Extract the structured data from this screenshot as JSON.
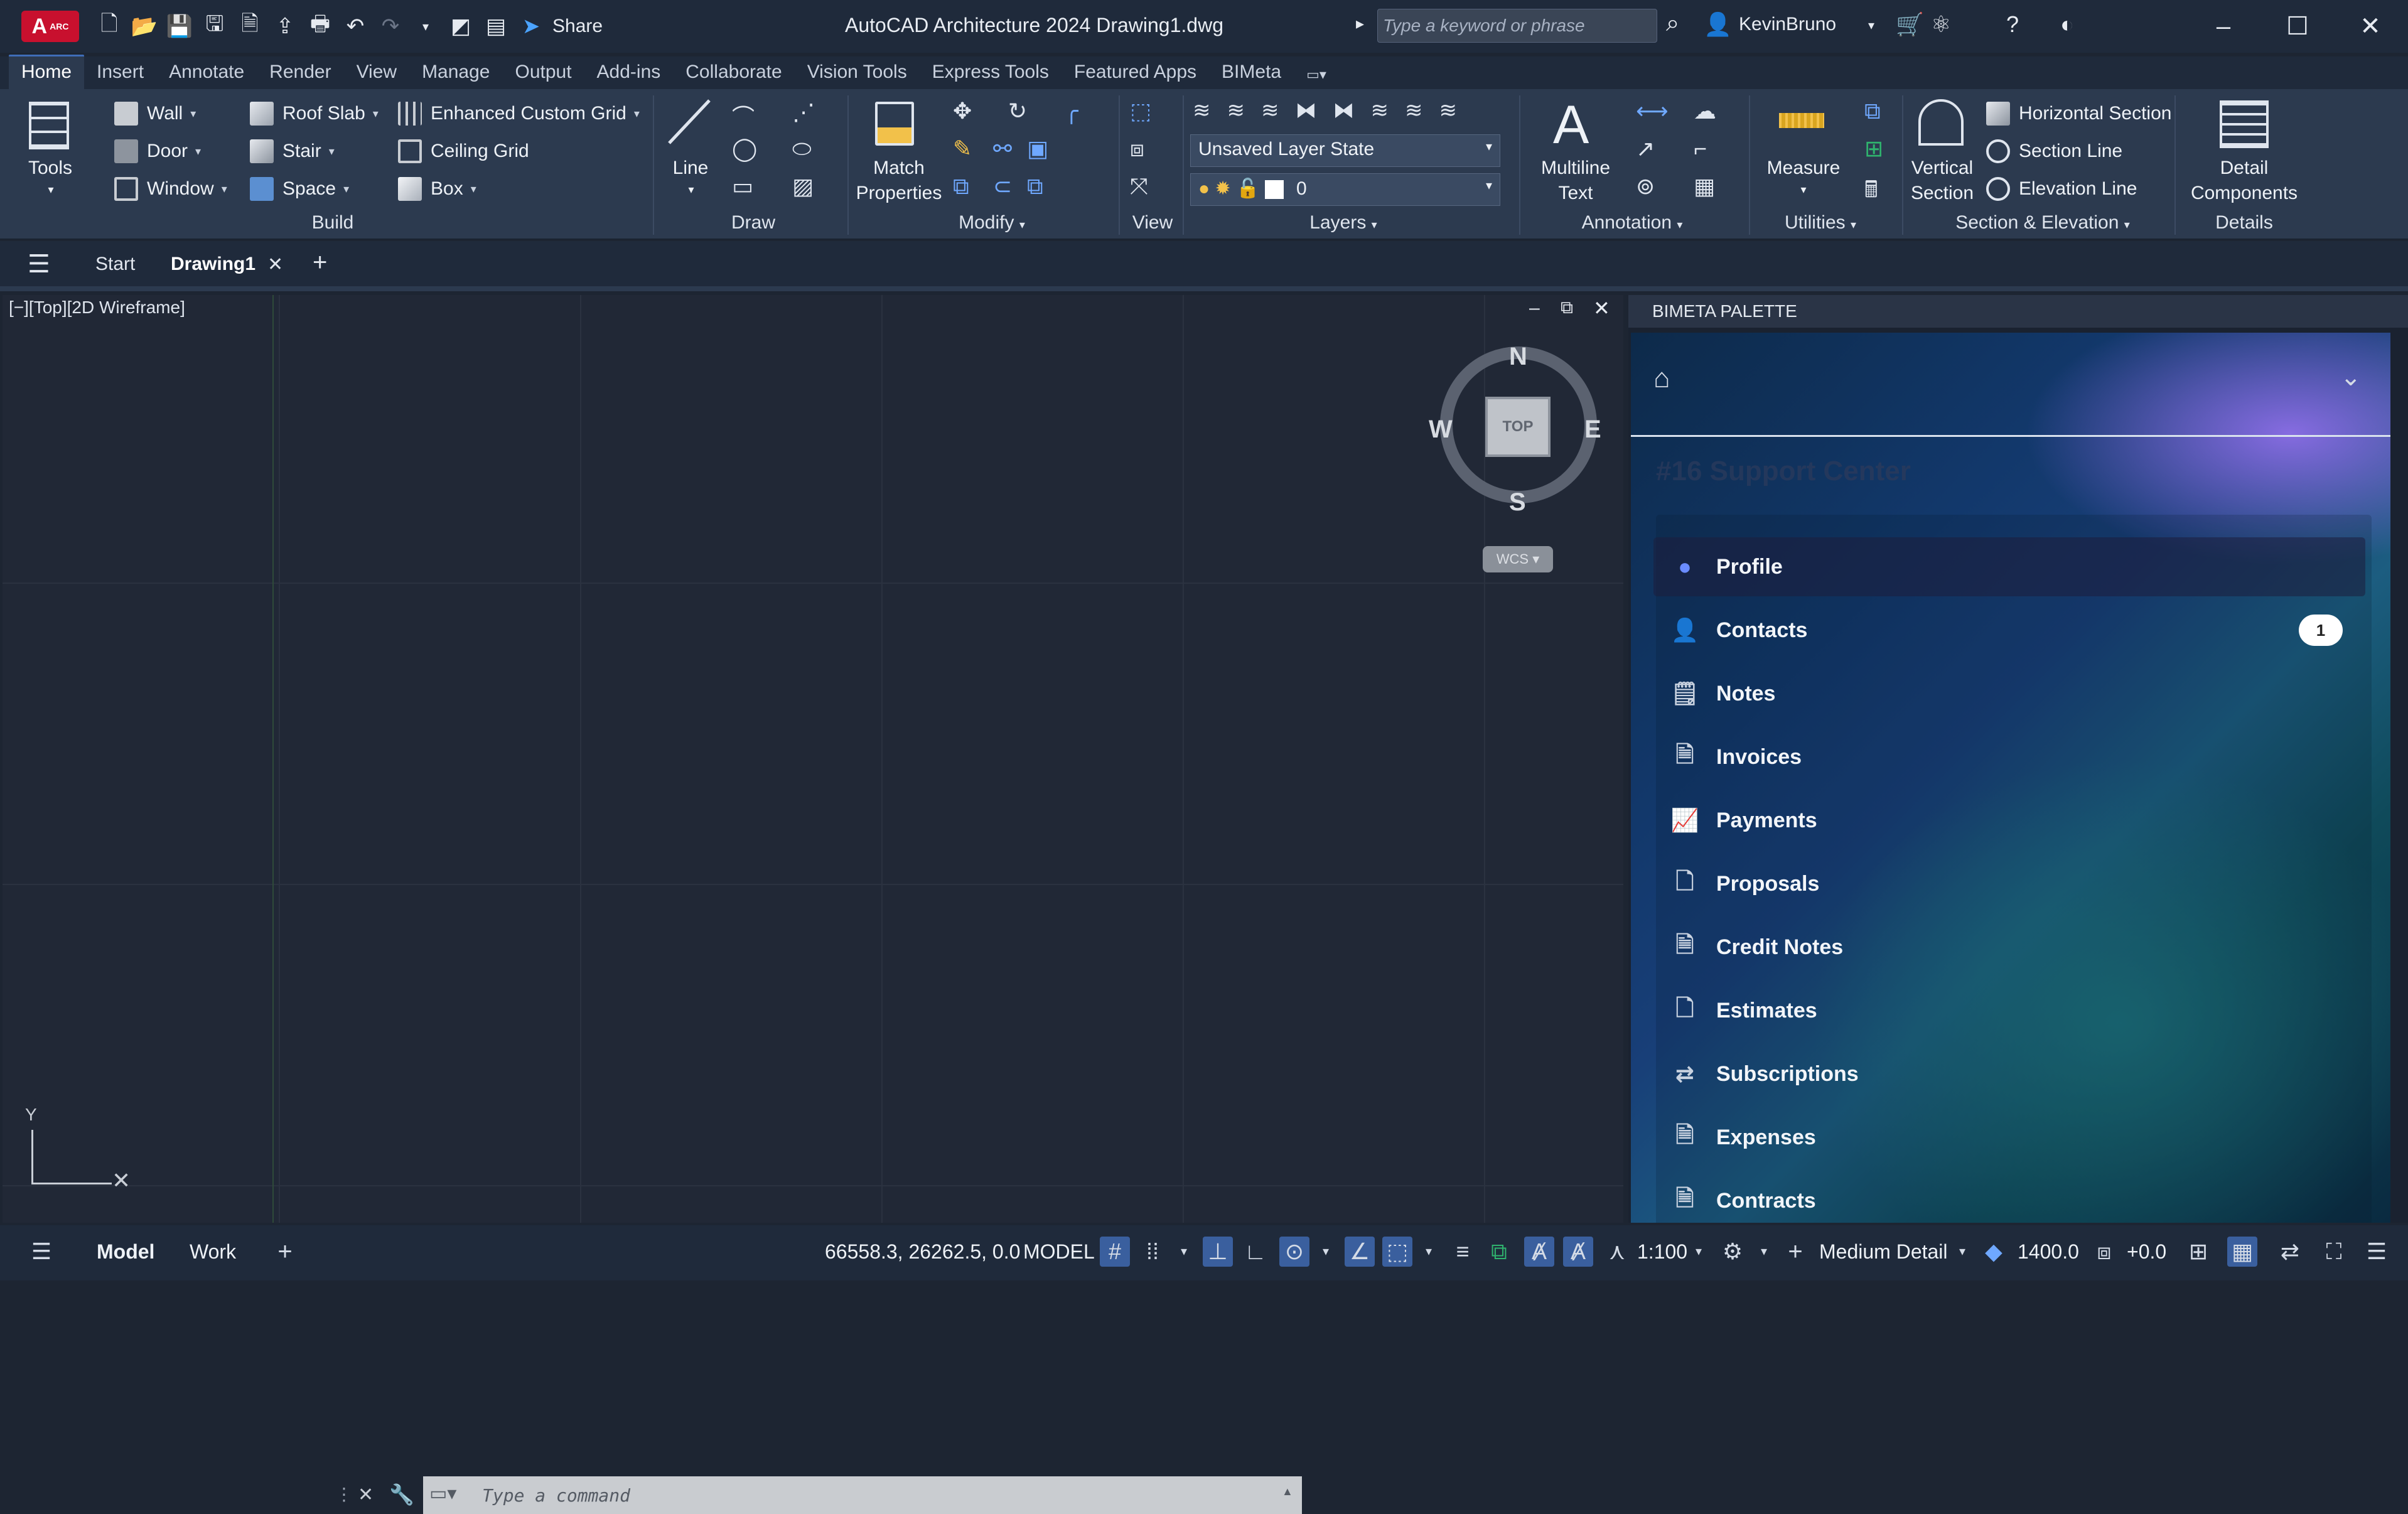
{
  "titlebar": {
    "app_badge": "A",
    "app_badge_small": "ARC",
    "share_label": "Share",
    "title": "AutoCAD Architecture 2024    Drawing1.dwg",
    "search_placeholder": "Type a keyword or phrase",
    "user": "KevinBruno"
  },
  "ribbon_tabs": [
    "Home",
    "Insert",
    "Annotate",
    "Render",
    "View",
    "Manage",
    "Output",
    "Add-ins",
    "Collaborate",
    "Vision Tools",
    "Express Tools",
    "Featured Apps",
    "BIMeta"
  ],
  "ribbon": {
    "tools_label": "Tools",
    "build": {
      "title": "Build",
      "wall": "Wall",
      "door": "Door",
      "window": "Window",
      "roof_slab": "Roof Slab",
      "stair": "Stair",
      "space": "Space",
      "enhanced_custom_grid": "Enhanced Custom Grid",
      "ceiling_grid": "Ceiling Grid",
      "box": "Box"
    },
    "draw": {
      "title": "Draw",
      "line": "Line"
    },
    "modify": {
      "title": "Modify",
      "match_properties_1": "Match",
      "match_properties_2": "Properties"
    },
    "view": {
      "title": "View"
    },
    "layers": {
      "title": "Layers",
      "layer_state": "Unsaved Layer State",
      "current_layer": "0"
    },
    "annotation": {
      "title": "Annotation",
      "multiline_1": "Multiline",
      "multiline_2": "Text"
    },
    "utilities": {
      "title": "Utilities",
      "measure": "Measure"
    },
    "section": {
      "title": "Section & Elevation",
      "vertical_1": "Vertical",
      "vertical_2": "Section",
      "horizontal_section": "Horizontal Section",
      "section_line": "Section Line",
      "elevation_line": "Elevation Line"
    },
    "details": {
      "title": "Details",
      "detail_1": "Detail",
      "detail_2": "Components"
    }
  },
  "doctabs": {
    "start": "Start",
    "drawing": "Drawing1"
  },
  "viewport": {
    "label": "[−][Top][2D Wireframe]",
    "viewcube": {
      "top": "TOP",
      "n": "N",
      "s": "S",
      "e": "E",
      "w": "W",
      "wcs": "WCS"
    },
    "ucs_y": "Y"
  },
  "command_line": {
    "placeholder": "Type a command"
  },
  "palette": {
    "header": "BIMETA PALETTE",
    "title": "#16 Support Center",
    "menu": [
      {
        "label": "Profile",
        "icon": "profile-icon",
        "glyph": "●"
      },
      {
        "label": "Contacts",
        "icon": "contacts-icon",
        "glyph": "👤",
        "badge": "1"
      },
      {
        "label": "Notes",
        "icon": "notes-icon",
        "glyph": "🗒"
      },
      {
        "label": "Invoices",
        "icon": "invoices-icon",
        "glyph": "🗎"
      },
      {
        "label": "Payments",
        "icon": "payments-icon",
        "glyph": "📈"
      },
      {
        "label": "Proposals",
        "icon": "proposals-icon",
        "glyph": "🗋"
      },
      {
        "label": "Credit Notes",
        "icon": "credit-notes-icon",
        "glyph": "🗎"
      },
      {
        "label": "Estimates",
        "icon": "estimates-icon",
        "glyph": "🗋"
      },
      {
        "label": "Subscriptions",
        "icon": "subscriptions-icon",
        "glyph": "⇄"
      },
      {
        "label": "Expenses",
        "icon": "expenses-icon",
        "glyph": "🗎"
      },
      {
        "label": "Contracts",
        "icon": "contracts-icon",
        "glyph": "🗎"
      }
    ]
  },
  "statusbar": {
    "model_tab": "Model",
    "work_tab": "Work",
    "coords": "66558.3, 26262.5, 0.0",
    "mode": "MODEL",
    "scale": "1:100",
    "detail_level": "Medium Detail",
    "elevation": "1400.0",
    "offset": "+0.0"
  },
  "colors": {
    "accent": "#3f6db8",
    "app_red": "#c8102e"
  }
}
